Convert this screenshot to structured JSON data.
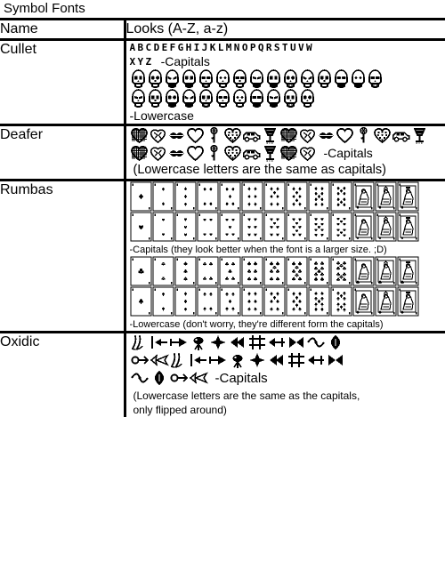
{
  "page_title": "Symbol Fonts",
  "table": {
    "headers": {
      "name": "Name",
      "looks": "Looks (A-Z, a-z)"
    },
    "rows": [
      {
        "name": "Cullet",
        "capitals_line1": "ABCDEFGHIJKLMNOPQRSTUVW",
        "capitals_line2": "XYZ",
        "capitals_label": "-Capitals",
        "lowercase_label": "-Lowercase",
        "glyph_style": "skull",
        "lowercase_count": 26,
        "capitals_count": 26
      },
      {
        "name": "Deafer",
        "capitals_label": "-Capitals",
        "note": "(Lowercase letters are the same as capitals)",
        "glyph_style": "romance",
        "capitals_count": 26
      },
      {
        "name": "Rumbas",
        "capitals_label": "-Capitals (they look better when the font is a larger size. ;D)",
        "lowercase_label": "-Lowercase (don't worry, they're different form the capitals)",
        "glyph_style": "playing-card",
        "capitals_row1_suit": "diamonds",
        "capitals_row2_suit": "hearts",
        "lowercase_row1_suit": "clubs",
        "lowercase_row2_suit": "spades",
        "card_ranks": [
          "A",
          "2",
          "3",
          "4",
          "5",
          "6",
          "7",
          "8",
          "9",
          "10",
          "J",
          "Q",
          "K"
        ]
      },
      {
        "name": "Oxidic",
        "capitals_label": "-Capitals",
        "note_line1": "(Lowercase letters are the same as the capitals,",
        "note_line2": "only flipped around)",
        "glyph_style": "ornament",
        "capitals_count": 26
      }
    ]
  },
  "colors": {
    "ink": "#000000",
    "paper": "#ffffff",
    "rule": "#000000"
  }
}
